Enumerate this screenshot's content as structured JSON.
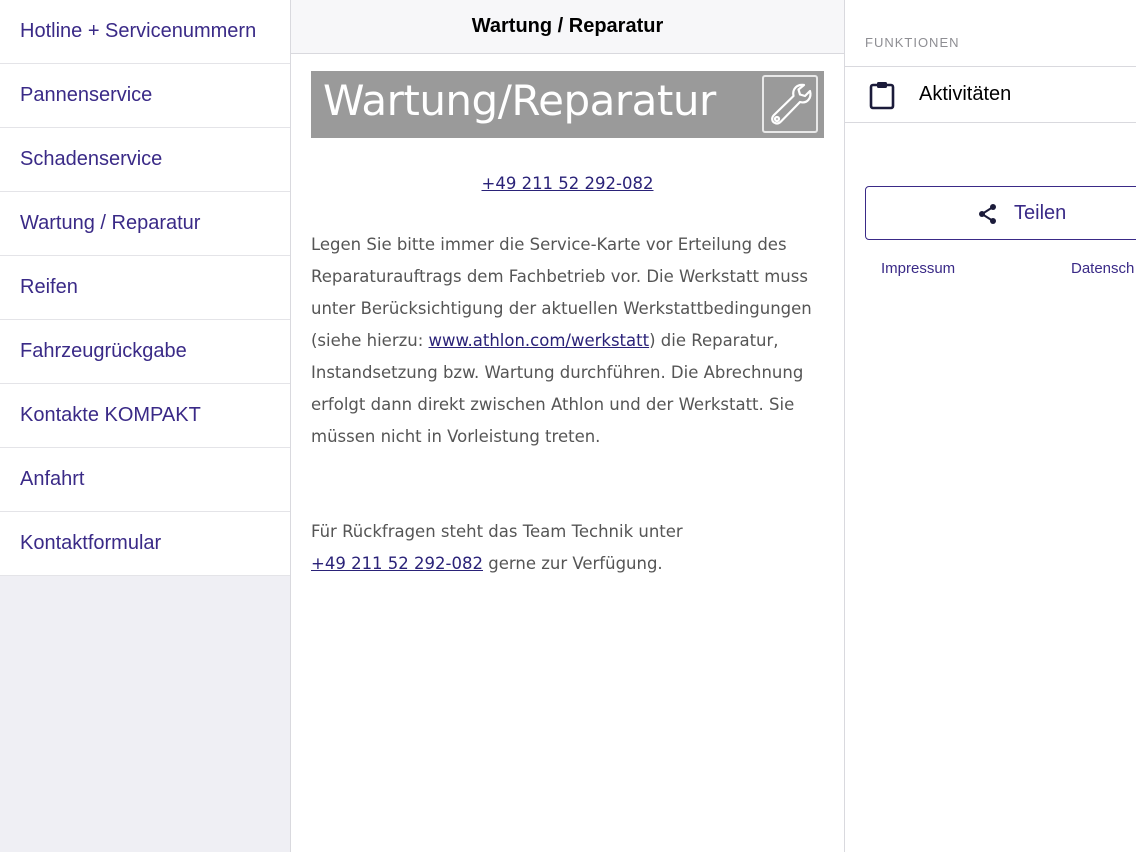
{
  "sidebar": {
    "items": [
      {
        "label": "Hotline + Servicenummern"
      },
      {
        "label": "Pannenservice"
      },
      {
        "label": "Schadenservice"
      },
      {
        "label": "Wartung / Reparatur"
      },
      {
        "label": "Reifen"
      },
      {
        "label": "Fahrzeugrückgabe"
      },
      {
        "label": "Kontakte KOMPAKT"
      },
      {
        "label": "Anfahrt"
      },
      {
        "label": "Kontaktformular"
      }
    ]
  },
  "content": {
    "title": "Wartung / Reparatur",
    "banner_text": "Wartung/Reparatur",
    "banner_icon": "wrench-icon",
    "phone_link": "+49 211 52 292-082",
    "paragraph1_before": "Legen Sie bitte immer die Service-Karte vor Erteilung des Reparaturauftrags dem Fachbetrieb vor. Die Werkstatt muss unter Berücksichtigung der aktuellen Werkstattbedingungen (siehe hierzu: ",
    "paragraph1_link": "www.athlon.com/werkstatt",
    "paragraph1_after": ") die Reparatur, Instandsetzung bzw. Wartung durchführen. Die Abrechnung erfolgt dann direkt zwischen Athlon und der Werkstatt. Sie müssen nicht in Vorleistung treten.",
    "paragraph2_before": "Für Rückfragen steht das Team Technik unter ",
    "paragraph2_link": "+49 211 52 292-082",
    "paragraph2_after": " gerne zur Verfügung."
  },
  "functions": {
    "header": "FUNKTIONEN",
    "activities_label": "Aktivitäten",
    "activities_icon": "clipboard-icon",
    "share_label": "Teilen",
    "share_icon": "share-icon",
    "impressum_label": "Impressum",
    "datenschutz_label": "Datensch"
  },
  "colors": {
    "accent": "#3a2a87",
    "text_gray": "#555555",
    "banner_bg": "#9a9a9a",
    "sidebar_bg": "#efeff4"
  }
}
